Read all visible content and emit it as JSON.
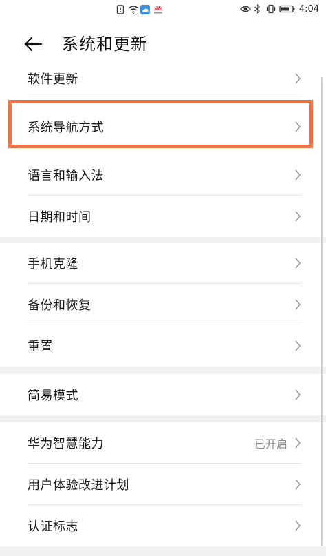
{
  "status_bar": {
    "time": "4:04",
    "left_icons": [
      "sim-alert-icon",
      "wifi-icon",
      "weather-icon",
      "huawei-logo"
    ],
    "right_icons": [
      "eye-icon",
      "bluetooth-icon",
      "vibrate-icon",
      "battery-icon"
    ]
  },
  "header": {
    "title": "系统和更新"
  },
  "groups": [
    {
      "items": [
        {
          "label": "软件更新"
        },
        {
          "label": "系统导航方式"
        },
        {
          "label": "语言和输入法"
        },
        {
          "label": "日期和时间"
        }
      ]
    },
    {
      "items": [
        {
          "label": "手机克隆"
        },
        {
          "label": "备份和恢复"
        },
        {
          "label": "重置"
        }
      ]
    },
    {
      "items": [
        {
          "label": "简易模式"
        }
      ]
    },
    {
      "items": [
        {
          "label": "华为智慧能力",
          "value": "已开启"
        },
        {
          "label": "用户体验改进计划"
        },
        {
          "label": "认证标志"
        }
      ]
    }
  ],
  "colors": {
    "highlight": "#e8764a",
    "background": "#f1f1f1",
    "card": "#ffffff",
    "secondary_text": "#8a8a8a",
    "chevron": "#9e9e9e"
  }
}
